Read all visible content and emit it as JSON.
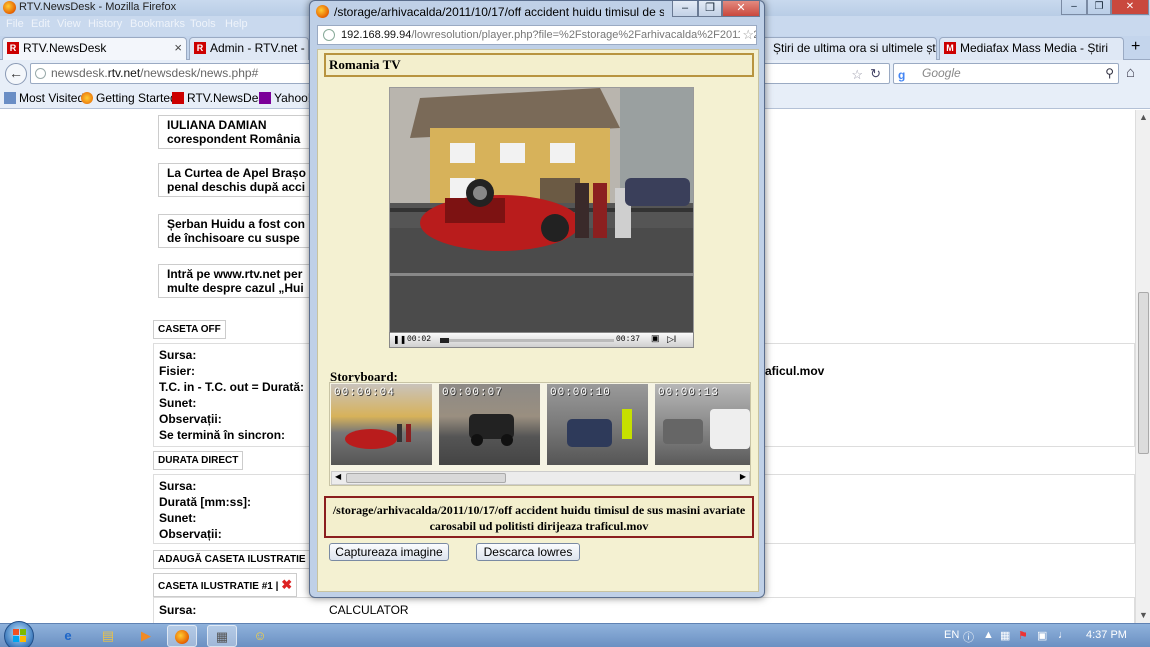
{
  "browser": {
    "window_title": "RTV.NewsDesk - Mozilla Firefox",
    "menu": [
      "File",
      "Edit",
      "View",
      "History",
      "Bookmarks",
      "Tools",
      "Help"
    ],
    "tabs": [
      {
        "label": "RTV.NewsDesk",
        "active": true
      },
      {
        "label": "Admin - RTV.net -",
        "active": false
      },
      {
        "label": "Știri de ultima ora si ultimele știr...",
        "active": false
      },
      {
        "label": "Mediafax Mass Media - Știri",
        "active": false
      }
    ],
    "new_tab": "+",
    "url_domain_pre": "newsdesk.",
    "url_domain": "rtv.net",
    "url_path": "/newsdesk/news.php#",
    "search_placeholder": "Google",
    "bookmarks": [
      "Most Visited",
      "Getting Started",
      "RTV.NewsDesk",
      "Yahoo!"
    ]
  },
  "page": {
    "news_items": [
      {
        "line1": "IULIANA DAMIAN",
        "line2": "corespondent România"
      },
      {
        "line1": "La Curtea de Apel Brașo",
        "line2": "penal deschis după acci"
      },
      {
        "line1": "Șerban Huidu a fost con",
        "line2": "de închisoare cu suspe"
      },
      {
        "line1": "Intră pe www.rtv.net per",
        "line2": "multe despre cazul „Hui"
      }
    ],
    "caseta_off": {
      "tab": "CASETA OFF",
      "fields": [
        "Sursa:",
        "Fisier:",
        "T.C. in - T.C. out = Durată:",
        "Sunet:",
        "Observații:",
        "Se termină în sincron:"
      ],
      "fisier_value": "aficul.mov"
    },
    "durata_direct": {
      "tab": "DURATA DIRECT",
      "fields": [
        "Sursa:",
        "Durată [mm:ss]:",
        "Sunet:",
        "Observații:"
      ]
    },
    "adauga_tab": "ADAUGĂ CASETA ILUSTRATIE",
    "caseta_ilustratie": {
      "tab": "CASETA ILUSTRATIE #1",
      "separator": "|",
      "fields": [
        "Sursa:"
      ],
      "sursa_value": "CALCULATOR"
    }
  },
  "popup": {
    "title": "/storage/arhivacalda/2011/10/17/off accident huidu timisul de sus masini...",
    "url_host": "192.168.99.94",
    "url_rest": "/lowresolution/player.php?file=%2Fstorage%2Farhivacalda%2F2011%2F10%",
    "header": "Romania TV",
    "player": {
      "time_current": "00:02",
      "time_total": "00:37",
      "progress": 0.05
    },
    "storyboard_label": "Storyboard:",
    "thumbnails": [
      "00:00:04",
      "00:00:07",
      "00:00:10",
      "00:00:13"
    ],
    "filename": "/storage/arhivacalda/2011/10/17/off accident huidu timisul de sus masini avariate carosabil ud politisti dirijeaza traficul.mov",
    "btn_capture": "Captureaza imagine",
    "btn_download": "Descarca lowres"
  },
  "taskbar": {
    "language": "EN",
    "clock": "4:37 PM"
  }
}
